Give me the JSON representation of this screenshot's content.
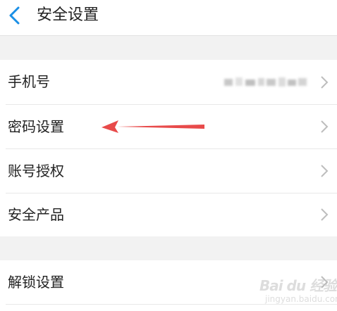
{
  "header": {
    "title": "安全设置",
    "back_icon": "chevron-left-icon",
    "accent_color": "#1a8fe6"
  },
  "rows": [
    {
      "label": "手机号",
      "value_redacted": true,
      "chevron": "chevron-right-icon"
    },
    {
      "label": "密码设置",
      "chevron": "chevron-right-icon"
    },
    {
      "label": "账号授权",
      "chevron": "chevron-right-icon"
    },
    {
      "label": "安全产品",
      "chevron": "chevron-right-icon"
    },
    {
      "label": "解锁设置",
      "chevron": "chevron-right-icon"
    }
  ],
  "annotation": {
    "type": "arrow",
    "points_to": "密码设置",
    "color": "#e84a4a"
  },
  "watermark": {
    "text": "Bai du 经验",
    "sub": "jingyan.baidu.com"
  }
}
